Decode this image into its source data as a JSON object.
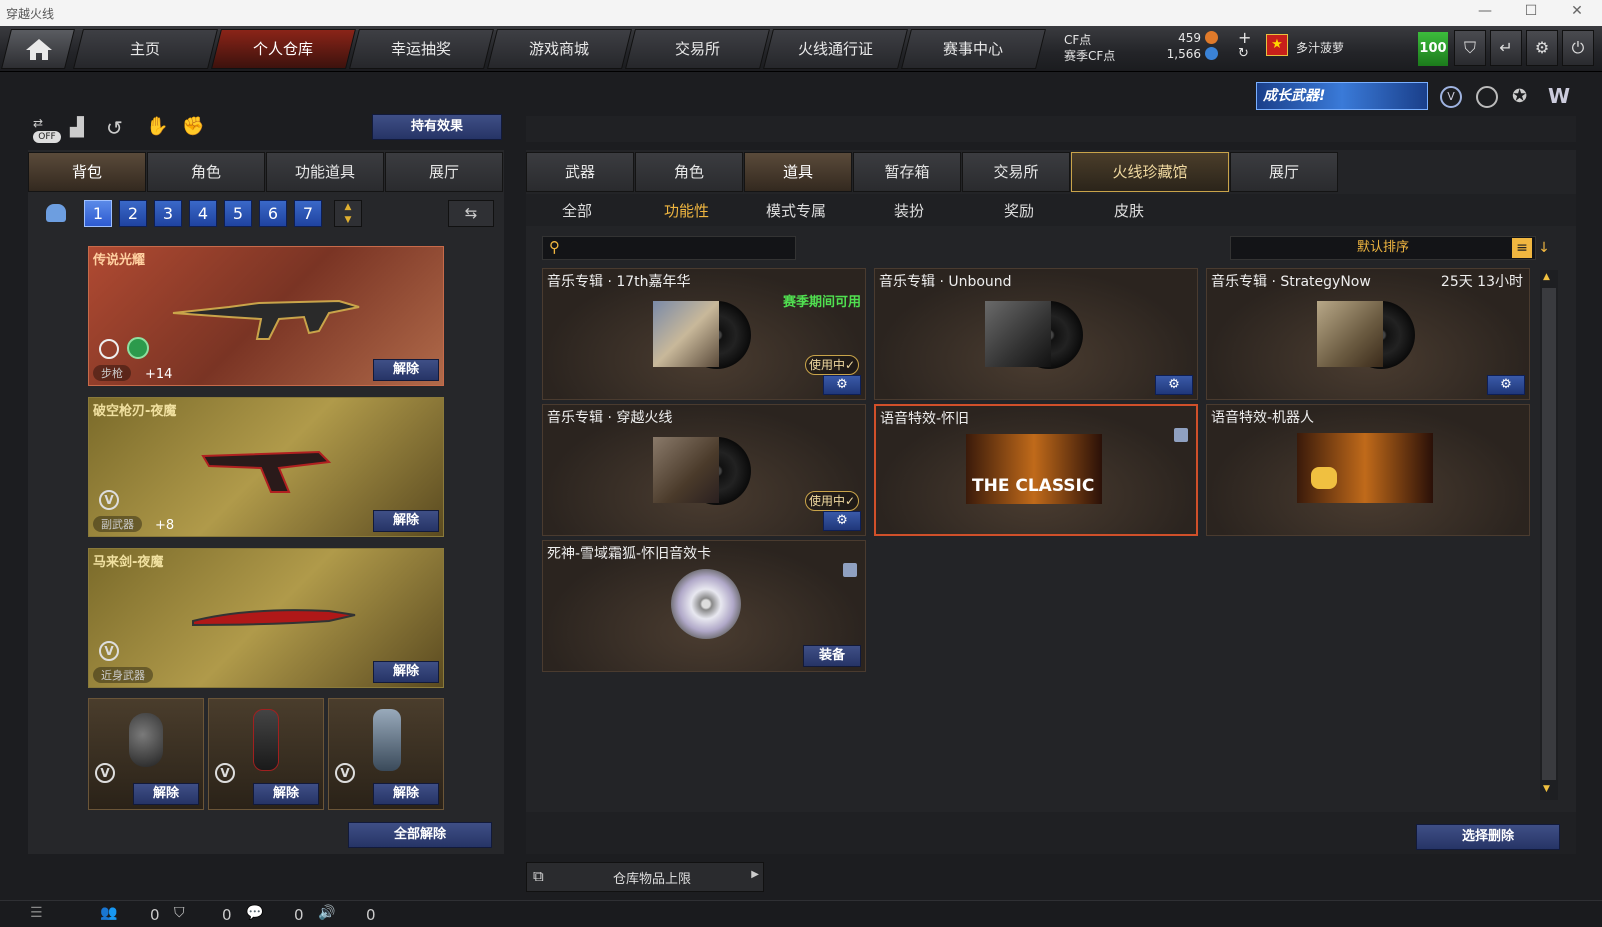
{
  "window": {
    "title": "穿越火线",
    "controls": [
      "—",
      "☐",
      "✕"
    ]
  },
  "nav": {
    "tabs": [
      "主页",
      "个人仓库",
      "幸运抽奖",
      "游戏商城",
      "交易所",
      "火线通行证",
      "赛事中心"
    ],
    "active": 1
  },
  "currency": {
    "cf_label": "CF点",
    "cf_value": "459",
    "season_label": "赛季CF点",
    "season_value": "1,566"
  },
  "user": {
    "name": "多汁菠萝",
    "level": "100"
  },
  "banner": {
    "text": "成长武器!"
  },
  "left": {
    "toggle_label": "OFF",
    "effects_button": "持有效果",
    "tabs": [
      "背包",
      "角色",
      "功能道具",
      "展厅"
    ],
    "slots": [
      "1",
      "2",
      "3",
      "4",
      "5",
      "6",
      "7"
    ],
    "weapons": [
      {
        "name": "传说光耀",
        "type": "步枪",
        "plus": "+14",
        "release": "解除"
      },
      {
        "name": "破空枪刃-夜魔",
        "type": "副武器",
        "plus": "+8",
        "release": "解除"
      },
      {
        "name": "马来剑-夜魔",
        "type": "近身武器",
        "plus": "",
        "release": "解除"
      }
    ],
    "grenades": [
      {
        "release": "解除"
      },
      {
        "release": "解除"
      },
      {
        "release": "解除"
      }
    ],
    "release_all": "全部解除"
  },
  "right": {
    "tabs": [
      "武器",
      "角色",
      "道具",
      "暂存箱",
      "交易所",
      "火线珍藏馆",
      "展厅"
    ],
    "subtabs": [
      "全部",
      "功能性",
      "模式专属",
      "装扮",
      "奖励",
      "皮肤"
    ],
    "sort_label": "默认排序",
    "search_placeholder": "",
    "items": [
      {
        "name": "音乐专辑 · 17th嘉年华",
        "note": "赛季期间可用",
        "status": "使用中✓"
      },
      {
        "name": "音乐专辑 · Unbound"
      },
      {
        "name": "音乐专辑 · StrategyNow",
        "timer": "25天 13小时"
      },
      {
        "name": "音乐专辑 · 穿越火线",
        "status": "使用中✓"
      },
      {
        "name": "语音特效-怀旧",
        "art": "THE CLASSIC"
      },
      {
        "name": "语音特效-机器人"
      },
      {
        "name": "死神-雪域霜狐-怀旧音效卡",
        "action": "装备"
      }
    ],
    "select_delete": "选择删除",
    "storage_limit": "仓库物品上限"
  },
  "statusbar": {
    "counts": [
      "0",
      "0",
      "0",
      "0"
    ]
  }
}
